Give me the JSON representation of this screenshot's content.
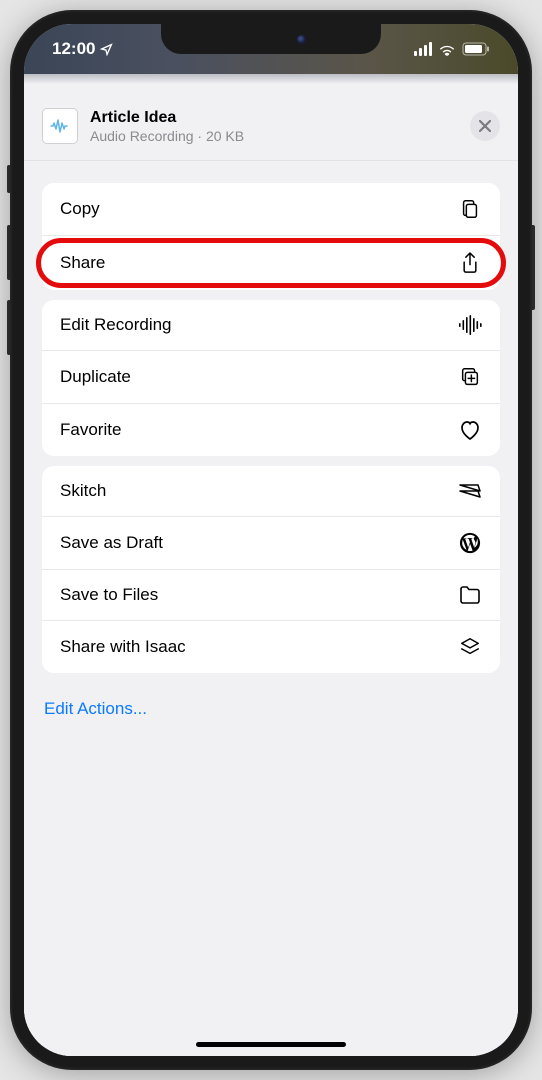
{
  "status": {
    "time": "12:00"
  },
  "header": {
    "title": "Article Idea",
    "subtitle": "Audio Recording · 20 KB"
  },
  "groups": [
    {
      "items": [
        {
          "id": "copy",
          "label": "Copy",
          "icon": "copy-icon",
          "highlighted": false
        },
        {
          "id": "share",
          "label": "Share",
          "icon": "share-icon",
          "highlighted": true
        }
      ]
    },
    {
      "items": [
        {
          "id": "edit-recording",
          "label": "Edit Recording",
          "icon": "waveform-icon",
          "highlighted": false
        },
        {
          "id": "duplicate",
          "label": "Duplicate",
          "icon": "duplicate-icon",
          "highlighted": false
        },
        {
          "id": "favorite",
          "label": "Favorite",
          "icon": "heart-icon",
          "highlighted": false
        }
      ]
    },
    {
      "items": [
        {
          "id": "skitch",
          "label": "Skitch",
          "icon": "skitch-icon",
          "highlighted": false
        },
        {
          "id": "save-as-draft",
          "label": "Save as Draft",
          "icon": "wordpress-icon",
          "highlighted": false
        },
        {
          "id": "save-to-files",
          "label": "Save to Files",
          "icon": "folder-icon",
          "highlighted": false
        },
        {
          "id": "share-with-isaac",
          "label": "Share with Isaac",
          "icon": "stack-icon",
          "highlighted": false
        }
      ]
    }
  ],
  "footer": {
    "edit_actions_label": "Edit Actions..."
  }
}
